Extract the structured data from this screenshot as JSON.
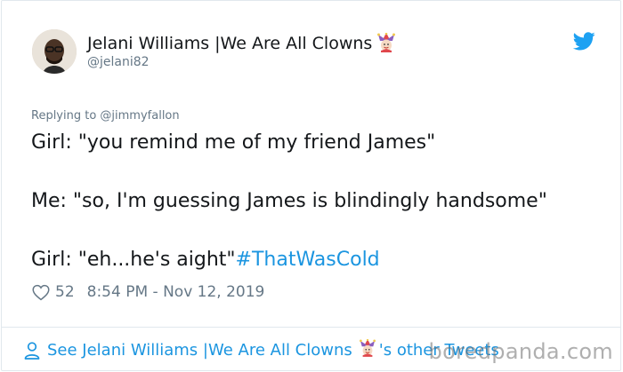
{
  "tweet": {
    "author_name": "Jelani Williams |We Are All Clowns",
    "author_handle": "@jelani82",
    "author_emoji": "jester-emoji",
    "reply_to": "Replying to @jimmyfallon",
    "lines": [
      "Girl: \"you remind me of my friend James\"",
      "Me: \"so, I'm guessing James is blindingly handsome\"",
      "Girl: \"eh...he's aight\""
    ],
    "hashtag": "#ThatWasCold",
    "likes": "52",
    "timestamp": "8:54 PM - Nov 12, 2019",
    "see_more_prefix": "See Jelani Williams |We Are All Clowns",
    "see_more_suffix": "'s other Tweets"
  },
  "icons": {
    "brand": "twitter-bird-icon",
    "like": "heart-icon",
    "profile": "person-icon"
  },
  "colors": {
    "accent": "#1b95e0",
    "muted": "#657786",
    "text": "#14171a",
    "border": "#e1e8ed"
  },
  "watermark": "boredpanda.com"
}
